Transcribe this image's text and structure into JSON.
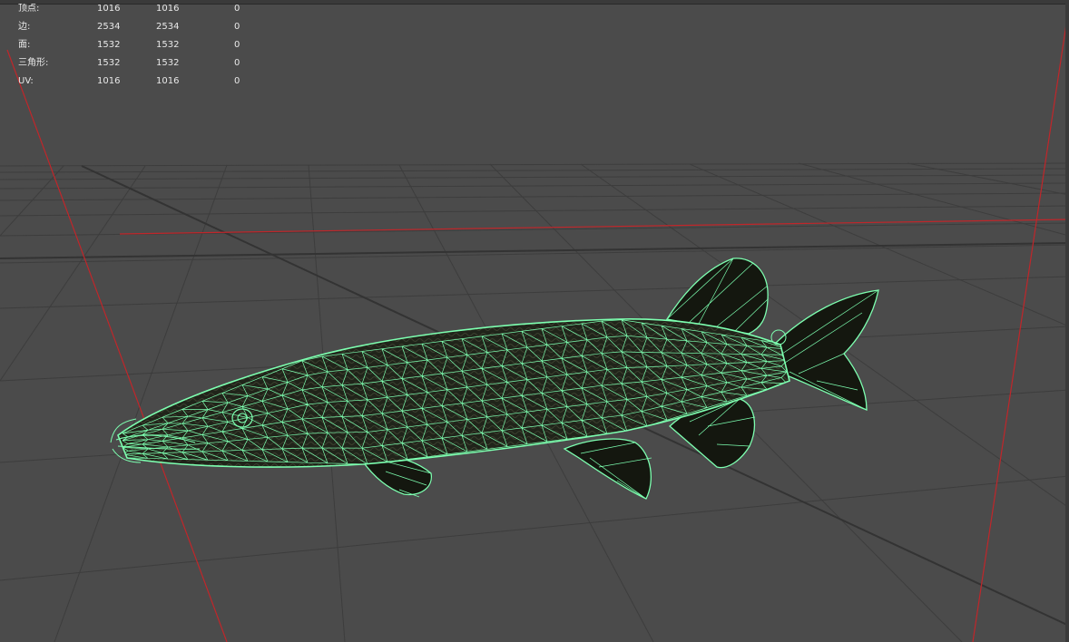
{
  "hud": {
    "rows": [
      {
        "label": "顶点:",
        "v1": "1016",
        "v2": "1016",
        "v3": "0"
      },
      {
        "label": "边:",
        "v1": "2534",
        "v2": "2534",
        "v3": "0"
      },
      {
        "label": "面:",
        "v1": "1532",
        "v2": "1532",
        "v3": "0"
      },
      {
        "label": "三角形:",
        "v1": "1532",
        "v2": "1532",
        "v3": "0"
      },
      {
        "label": "UV:",
        "v1": "1016",
        "v2": "1016",
        "v3": "0"
      }
    ]
  },
  "colors": {
    "background": "#4b4b4b",
    "grid": "#3c3c3c",
    "axis_red": "#c0262a",
    "wireframe": "#7dffb0",
    "mesh_fill": "#1c1f16",
    "hud_text": "#e8e8e8"
  },
  "scene": {
    "object": "pike-fish-mesh",
    "display": "wireframe-on-shaded"
  }
}
